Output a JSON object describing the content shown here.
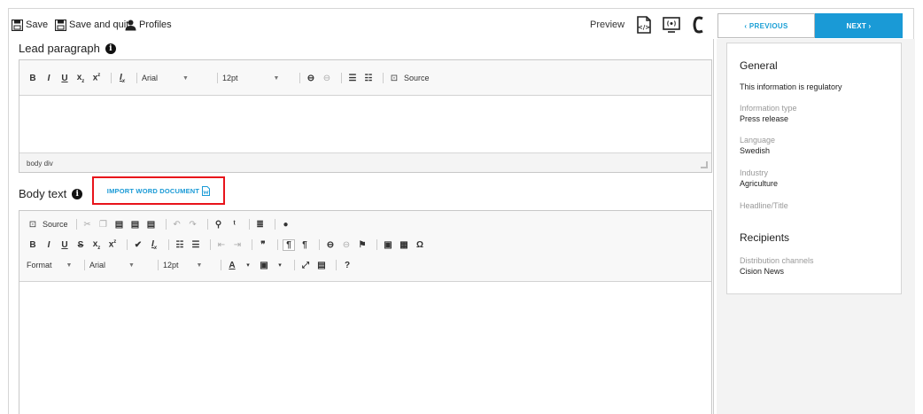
{
  "toolbar": {
    "save_label": "Save",
    "save_quit_label": "Save and quit",
    "profiles_label": "Profiles",
    "preview_label": "Preview",
    "preview_icons": [
      "html-preview-icon",
      "broadcast-preview-icon",
      "cision-logo-icon"
    ]
  },
  "nav": {
    "previous_label": "‹ PREVIOUS",
    "next_label": "NEXT ›"
  },
  "lead": {
    "label": "Lead paragraph",
    "font_name": "Arial",
    "font_size": "12pt",
    "source_label": "Source",
    "status_path": "body  div"
  },
  "body_text": {
    "label": "Body text",
    "import_label": "IMPORT WORD DOCUMENT",
    "source_label": "Source",
    "format_label": "Format",
    "font_name": "Arial",
    "font_size": "12pt",
    "help_label": "?"
  },
  "side": {
    "general_heading": "General",
    "regulatory_text": "This information is regulatory",
    "info_type_label": "Information type",
    "info_type_value": "Press release",
    "language_label": "Language",
    "language_value": "Swedish",
    "industry_label": "Industry",
    "industry_value": "Agriculture",
    "headline_label": "Headline/Title",
    "recipients_heading": "Recipients",
    "channels_label": "Distribution channels",
    "channels_value": "Cision News"
  },
  "colors": {
    "accent": "#1a9ad6",
    "highlight_box": "#e8141b",
    "panel_bg": "#f3f3f3"
  }
}
